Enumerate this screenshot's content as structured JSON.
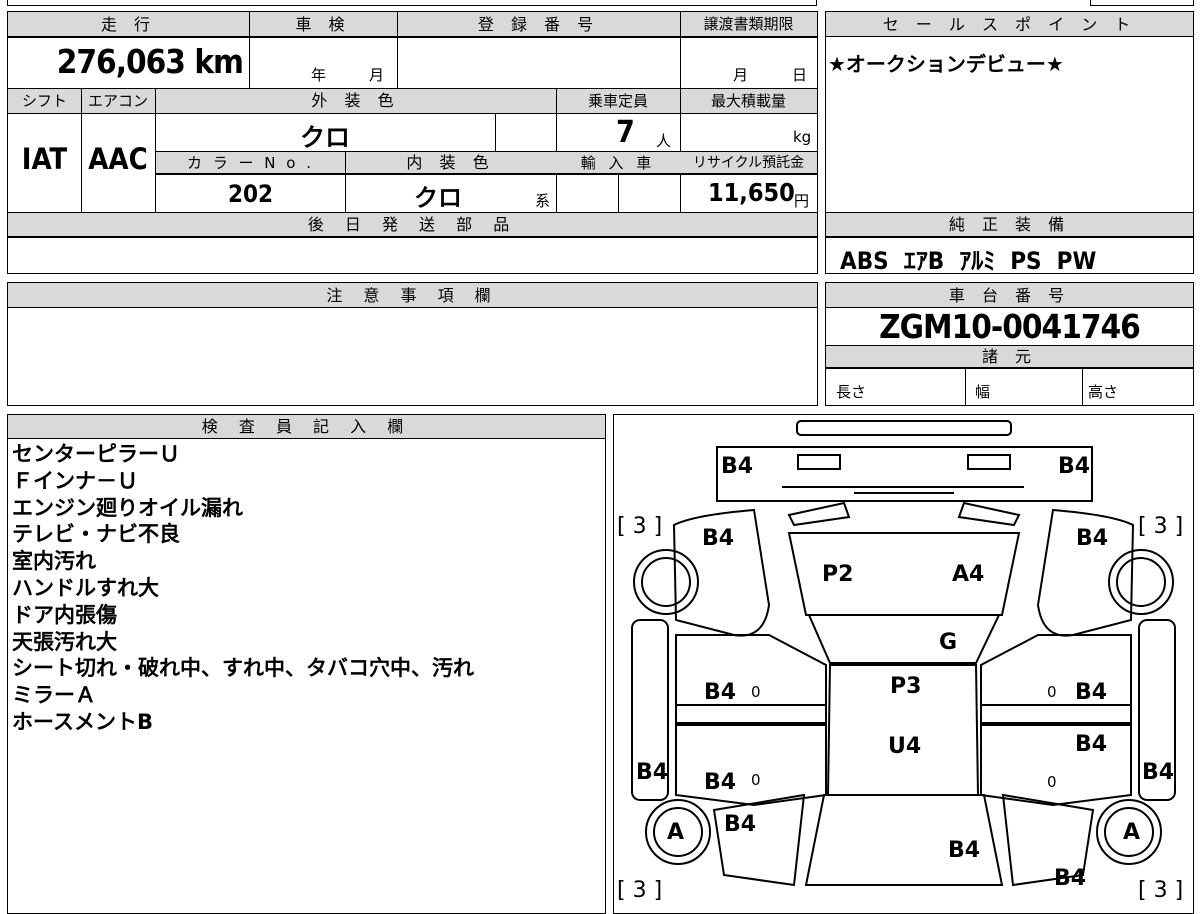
{
  "top_info": {
    "headers": {
      "mileage": "走 行",
      "inspection": "車 検",
      "registration": "登 録 番 号",
      "transfer_deadline": "譲渡書類期限",
      "shift": "シフト",
      "aircon": "エアコン",
      "exterior_color": "外 装 色",
      "capacity": "乗車定員",
      "max_load": "最大積載量",
      "color_no": "カ ラ ー N o .",
      "interior_color": "内 装 色",
      "import": "輸 入 車",
      "recycle_fee": "リサイクル預託金",
      "later_parts": "後 日 発 送 部 品",
      "notes": "注 意 事 項 欄"
    },
    "mileage_value": "276,063",
    "mileage_unit": "km",
    "inspection_year": "年",
    "inspection_month": "月",
    "transfer_month": "月",
    "transfer_day": "日",
    "shift_value": "IAT",
    "aircon_value": "AAC",
    "exterior_color_value": "クロ",
    "capacity_value": "7",
    "capacity_unit": "人",
    "max_load_unit": "kg",
    "color_no_value": "202",
    "interior_color_value": "クロ",
    "interior_color_suffix": "系",
    "recycle_fee_value": "11,650",
    "recycle_fee_unit": "円"
  },
  "sales_point": {
    "header": "セ ー ル ス ポ イ ン ト",
    "text": "★オークションデビュー★"
  },
  "equipment": {
    "header": "純 正 装 備",
    "items": "ABS  ｴｱB  ｱﾙﾐ  PS  PW"
  },
  "chassis": {
    "header": "車 台 番 号",
    "number": "ZGM10-0041746",
    "specs_header": "諸 元",
    "length": "長さ",
    "width": "幅",
    "height": "高さ"
  },
  "inspector": {
    "header": "検 査 員 記 入 欄",
    "lines": [
      "センターピラーＵ",
      "Ｆインナ－Ｕ",
      "エンジン廻りオイル漏れ",
      "テレビ・ナビ不良",
      "室内汚れ",
      "ハンドルすれ大",
      "ドア内張傷",
      "天張汚れ大",
      "シート切れ・破れ中、すれ中、タバコ穴中、汚れ",
      "ミラーＡ",
      "ホースメントB"
    ]
  },
  "diagram": {
    "labels": {
      "top_left": "B4",
      "top_right": "B4",
      "fender_fl": "B4",
      "fender_fr": "B4",
      "hood_l": "P2",
      "hood_r": "A4",
      "windshield": "G",
      "door_fl": "B4",
      "door_fr": "B4",
      "roof_f": "P3",
      "roof_r": "U4",
      "door_rl": "B4",
      "door_rr": "B4",
      "rocker_l": "B4",
      "rocker_r": "B4",
      "quarter_l": "B4",
      "trunk": "B4",
      "quarter_r": "B4",
      "wheel_rl": "A",
      "wheel_rr": "A",
      "bracket_fl": "[ 3 ]",
      "bracket_fr": "[ 3 ]",
      "bracket_rl": "[ 3 ]",
      "bracket_rr": "[ 3 ]",
      "zero_1": "0",
      "zero_2": "0",
      "zero_3": "0",
      "zero_4": "0"
    }
  }
}
